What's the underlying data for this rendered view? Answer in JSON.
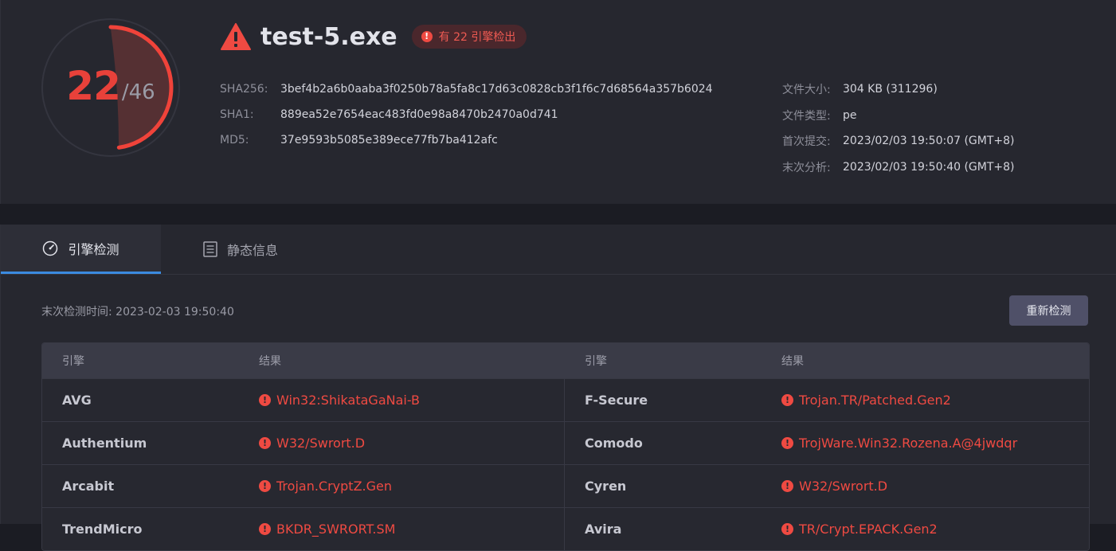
{
  "summary": {
    "detected": "22",
    "total": "/46",
    "detection_fraction": 0.4783,
    "file_name": "test-5.exe",
    "badge": "有 22 引擎检出",
    "hashes": [
      {
        "label": "SHA256:",
        "value": "3bef4b2a6b0aaba3f0250b78a5fa8c17d63c0828cb3f1f6c7d68564a357b6024"
      },
      {
        "label": "SHA1:",
        "value": "889ea52e7654eac483fd0e98a8470b2470a0d741"
      },
      {
        "label": "MD5:",
        "value": "37e9593b5085e389ece77fb7ba412afc"
      }
    ],
    "meta": [
      {
        "label": "文件大小:",
        "value": "304 KB (311296)"
      },
      {
        "label": "文件类型:",
        "value": "pe"
      },
      {
        "label": "首次提交:",
        "value": "2023/02/03 19:50:07 (GMT+8)"
      },
      {
        "label": "末次分析:",
        "value": "2023/02/03 19:50:40 (GMT+8)"
      }
    ]
  },
  "tabs": [
    {
      "label": "引擎检测",
      "icon": "gauge-icon",
      "active": true
    },
    {
      "label": "静态信息",
      "icon": "document-list-icon",
      "active": false
    }
  ],
  "detection": {
    "last_check": "末次检测时间: 2023-02-03 19:50:40",
    "rescan_label": "重新检测",
    "headers": [
      "引擎",
      "结果",
      "引擎",
      "结果"
    ],
    "rows": [
      {
        "engine1": "AVG",
        "result1": "Win32:ShikataGaNai-B",
        "engine2": "F-Secure",
        "result2": "Trojan.TR/Patched.Gen2"
      },
      {
        "engine1": "Authentium",
        "result1": "W32/Swrort.D",
        "engine2": "Comodo",
        "result2": "TrojWare.Win32.Rozena.A@4jwdqr"
      },
      {
        "engine1": "Arcabit",
        "result1": "Trojan.CryptZ.Gen",
        "engine2": "Cyren",
        "result2": "W32/Swrort.D"
      },
      {
        "engine1": "TrendMicro",
        "result1": "BKDR_SWRORT.SM",
        "engine2": "Avira",
        "result2": "TR/Crypt.EPACK.Gen2"
      }
    ]
  },
  "colors": {
    "danger": "#ef4a42",
    "accent_tab": "#3b8be0",
    "button": "#4f5068"
  }
}
